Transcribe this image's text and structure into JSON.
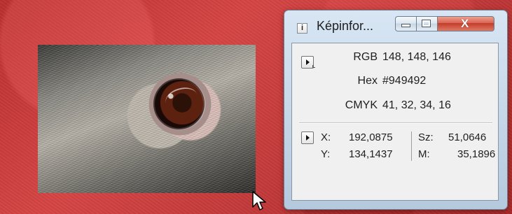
{
  "window": {
    "title": "Képinfor...",
    "title_icon": "i",
    "close_symbol": "X"
  },
  "colors": {
    "background_red": "#c23b3b",
    "window_frame": "#b5c9de",
    "panel_bg": "#f0f0f0",
    "close_red": "#c33c29"
  },
  "icons": {
    "title": "info-icon",
    "minimize": "minimize-icon",
    "maximize": "maximize-icon",
    "close": "close-icon",
    "expand_top": "play-icon",
    "expand_bottom": "play-icon",
    "cursor": "mouse-pointer-icon"
  },
  "info": {
    "rgb_label": "RGB",
    "rgb_value": "148, 148, 146",
    "hex_label": "Hex",
    "hex_value": "#949492",
    "cmyk_label": "CMYK",
    "cmyk_value": "41, 32, 34, 16"
  },
  "coordinates": {
    "x_label": "X:",
    "x_value": "192,0875",
    "y_label": "Y:",
    "y_value": "134,1437",
    "sz_label": "Sz:",
    "sz_value": "51,0646",
    "m_label": "M:",
    "m_value": "35,1896"
  }
}
